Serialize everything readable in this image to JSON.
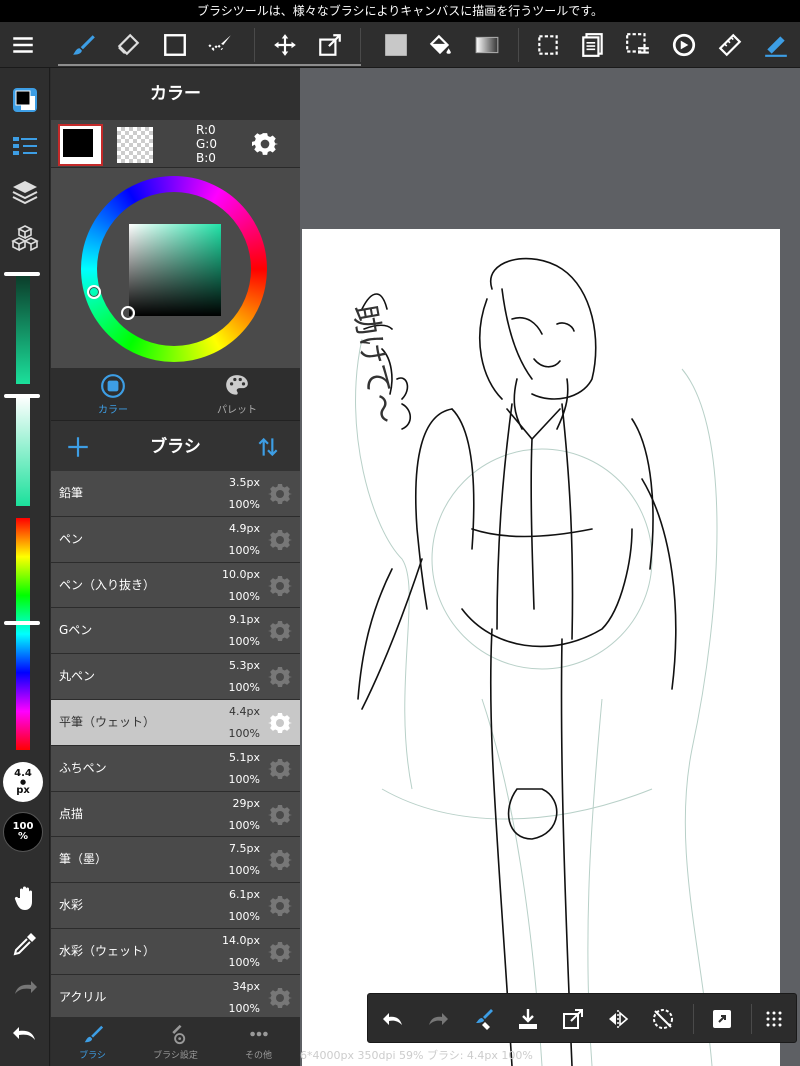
{
  "tip": "ブラシツールは、様々なブラシによりキャンバスに描画を行うツールです。",
  "colors": {
    "accent": "#3d9ee5",
    "panel_bg": "#3a3a3a",
    "toolbar_bg": "#2e2e2e",
    "canvas_bg": "#5e6064",
    "selected_row": "#c8c8c8"
  },
  "toolbar": {
    "items": [
      "menu-icon",
      "brush-icon",
      "eraser-icon",
      "rectangle-icon",
      "select-pen-icon",
      "move-icon",
      "transform-icon",
      "fill-color-icon",
      "bucket-icon",
      "gradient-icon",
      "select-rect-icon",
      "copy-page-icon",
      "deselect-icon",
      "rotate-icon",
      "ruler-icon",
      "snap-icon"
    ]
  },
  "left": {
    "brush_size_label": "4.4",
    "brush_size_unit": "px",
    "opacity_label": "100",
    "opacity_unit": "%",
    "sliders": {
      "green_level": 0.1,
      "white_level": 0.0,
      "hue_level": 0.45
    }
  },
  "color_panel": {
    "title": "カラー",
    "r": "R:0",
    "g": "G:0",
    "b": "B:0",
    "tabs": [
      {
        "label": "カラー",
        "active": true
      },
      {
        "label": "パレット",
        "active": false
      }
    ]
  },
  "brush_panel": {
    "title": "ブラシ",
    "brushes": [
      {
        "name": "鉛筆",
        "size": "3.5px",
        "opacity": "100%",
        "selected": false
      },
      {
        "name": "ペン",
        "size": "4.9px",
        "opacity": "100%",
        "selected": false
      },
      {
        "name": "ペン（入り抜き）",
        "size": "10.0px",
        "opacity": "100%",
        "selected": false
      },
      {
        "name": "Gペン",
        "size": "9.1px",
        "opacity": "100%",
        "selected": false
      },
      {
        "name": "丸ペン",
        "size": "5.3px",
        "opacity": "100%",
        "selected": false
      },
      {
        "name": "平筆（ウェット）",
        "size": "4.4px",
        "opacity": "100%",
        "selected": true
      },
      {
        "name": "ふちペン",
        "size": "5.1px",
        "opacity": "100%",
        "selected": false
      },
      {
        "name": "点描",
        "size": "29px",
        "opacity": "100%",
        "selected": false
      },
      {
        "name": "筆（墨）",
        "size": "7.5px",
        "opacity": "100%",
        "selected": false
      },
      {
        "name": "水彩",
        "size": "6.1px",
        "opacity": "100%",
        "selected": false
      },
      {
        "name": "水彩（ウェット）",
        "size": "14.0px",
        "opacity": "100%",
        "selected": false
      },
      {
        "name": "アクリル",
        "size": "34px",
        "opacity": "100%",
        "selected": false
      }
    ],
    "bottom_tabs": [
      {
        "label": "ブラシ",
        "active": true
      },
      {
        "label": "ブラシ設定",
        "active": false
      },
      {
        "label": "その他",
        "active": false
      }
    ]
  },
  "canvas": {
    "status": "6*4000px 350dpi 59% ブラシ: 4.4px 100%",
    "sketch_text": "助けて〜"
  },
  "float_bar": [
    "undo-icon",
    "redo-icon",
    "brush-eraser-icon",
    "import-icon",
    "export-icon",
    "flip-icon",
    "rotate-reset-icon",
    "fullscreen-icon",
    "more-icon"
  ]
}
